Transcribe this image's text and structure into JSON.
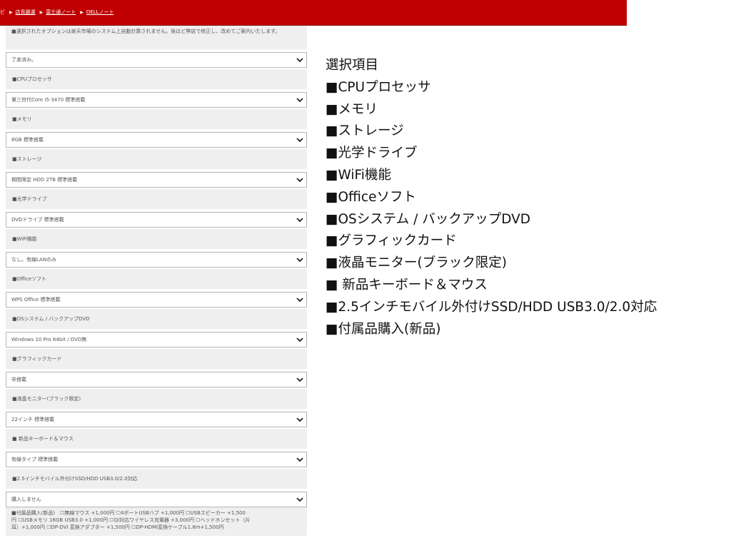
{
  "breadcrumb": {
    "first": "ビ",
    "items": [
      "店長厳選",
      "富士通ノート",
      "DELLノート"
    ]
  },
  "intro_note": "■選択されたオプションは楽天市場のシステム上自動計算されません。後ほど弊店で修正し、改めてご案内いたします。",
  "agreement_select": "了承済み。",
  "options": [
    {
      "label": "■CPUプロセッサ",
      "value": "第三世代Core i5-3470 標準搭載"
    },
    {
      "label": "■メモリ",
      "value": "8GB 標準搭載"
    },
    {
      "label": "■ストレージ",
      "value": "期間限定 HDD 2TB 標準搭載"
    },
    {
      "label": "■光学ドライブ",
      "value": "DVDドライブ 標準搭載"
    },
    {
      "label": "■WiFi機能",
      "value": "なし。有線LANのみ"
    },
    {
      "label": "■Officeソフト",
      "value": "WPS Office 標準搭載"
    },
    {
      "label": "■OSシステム / バックアップDVD",
      "value": "Windows 10 Pro 64bit / DVD無"
    },
    {
      "label": "■グラフィックカード",
      "value": "非搭載"
    },
    {
      "label": "■液晶モニター(ブラック限定)",
      "value": "22インチ 標準搭載"
    },
    {
      "label": "■ 新品キーボード＆マウス",
      "value": "有線タイプ 標準搭載"
    },
    {
      "label": "■2.5インチモバイル外付けSSD/HDD USB3.0/2.0対応",
      "value": "購入しません"
    }
  ],
  "accessories_note": [
    "■付属品購入(新品)　☐無線マウス +1,000円 ☐4ポートUSBハブ +1,000円 ☐USBスピーカー +1,500",
    "円 ☐USBメモリ 16GB USB3.0 +1,000円 ☐Qi対応ワイヤレス充電器 +3,000円 ☐ヘッドホンセット（片",
    "耳）+1,000円 ☐DP-DVI 変換アダプター +1,500円 ☐DP-HDMI変換ケーブル1.8m+1,500円"
  ],
  "summary": {
    "title": "選択項目",
    "items": [
      "■CPUプロセッサ",
      "■メモリ",
      "■ストレージ",
      "■光学ドライブ",
      "■WiFi機能",
      "■Officeソフト",
      "■OSシステム / バックアップDVD",
      "■グラフィックカード",
      "■液晶モニター(ブラック限定)",
      "■ 新品キーボード＆マウス",
      "■2.5インチモバイル外付けSSD/HDD USB3.0/2.0対応",
      "■付属品購入(新品)"
    ]
  },
  "colors": {
    "header": "#c00000",
    "panel": "#efefef",
    "border": "#b5b5b5"
  }
}
